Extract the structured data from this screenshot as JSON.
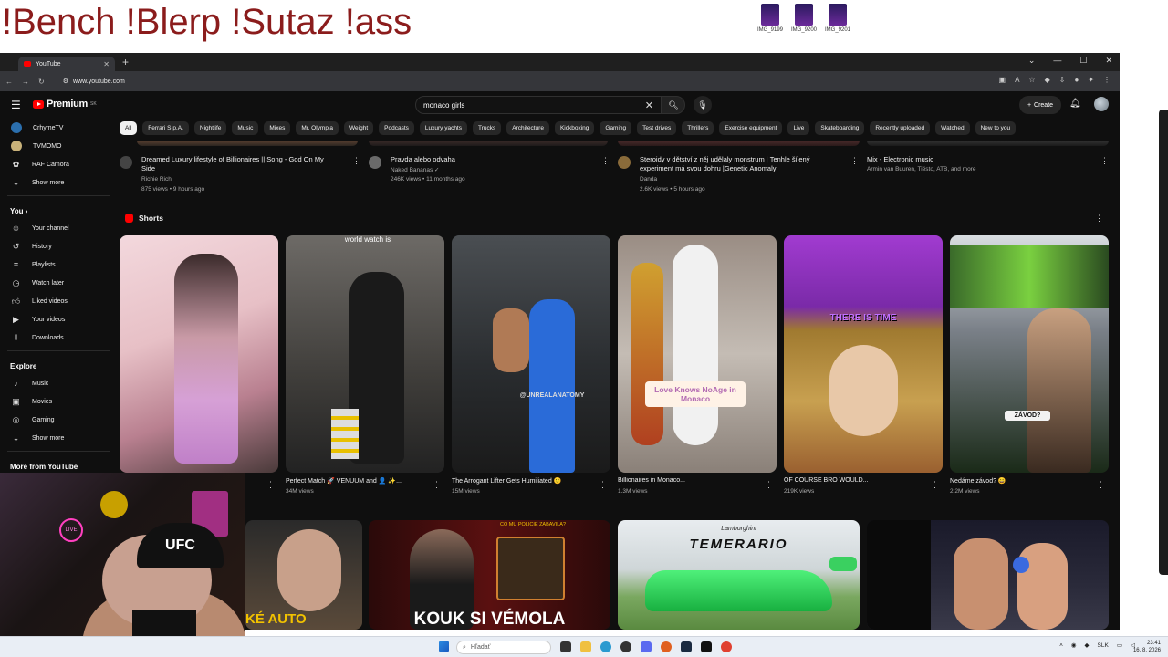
{
  "overlay": {
    "title": "!Bench !Blerp !Sutaz !ass"
  },
  "desktop": {
    "icons": [
      "IMG_9199",
      "IMG_9200",
      "IMG_9201"
    ]
  },
  "browser": {
    "tab_title": "YouTube",
    "url": "www.youtube.com"
  },
  "youtube": {
    "logo_text": "Premium",
    "logo_region": "SK",
    "search_value": "monaco girls",
    "create_label": "Create",
    "sidebar": {
      "subscriptions": [
        {
          "label": "CrhymeTV"
        },
        {
          "label": "TVMOMO"
        },
        {
          "label": "RAF Camora"
        },
        {
          "label": "Show more"
        }
      ],
      "you_heading": "You",
      "you_items": [
        {
          "label": "Your channel",
          "icon": "user-icon"
        },
        {
          "label": "History",
          "icon": "history-icon"
        },
        {
          "label": "Playlists",
          "icon": "playlists-icon"
        },
        {
          "label": "Watch later",
          "icon": "clock-icon"
        },
        {
          "label": "Liked videos",
          "icon": "thumb-up-icon"
        },
        {
          "label": "Your videos",
          "icon": "video-icon"
        },
        {
          "label": "Downloads",
          "icon": "download-icon"
        }
      ],
      "explore_heading": "Explore",
      "explore_items": [
        {
          "label": "Music",
          "icon": "music-icon"
        },
        {
          "label": "Movies",
          "icon": "movies-icon"
        },
        {
          "label": "Gaming",
          "icon": "gaming-icon"
        },
        {
          "label": "Show more",
          "icon": "chevron-down-icon"
        }
      ],
      "more_heading": "More from YouTube"
    },
    "chips": [
      "All",
      "Ferrari S.p.A.",
      "Nightlife",
      "Music",
      "Mixes",
      "Mr. Olympia",
      "Weight",
      "Podcasts",
      "Luxury yachts",
      "Trucks",
      "Architecture",
      "Kickboxing",
      "Gaming",
      "Test drives",
      "Thrillers",
      "Exercise equipment",
      "Live",
      "Skateboarding",
      "Recently uploaded",
      "Watched",
      "New to you"
    ],
    "videos": [
      {
        "title": "Dreamed Luxury lifestyle of Billionaires || Song - God On My Side",
        "channel": "Richie Rich",
        "meta": "875 views • 9 hours ago"
      },
      {
        "title": "Pravda alebo odvaha",
        "channel": "Naked Bananas ✓",
        "meta": "246K views • 11 months ago"
      },
      {
        "title": "Steroidy v dětství z něj udělaly monstrum | Tenhle šílený experiment má svou dohru |Genetic Anomaly",
        "channel": "Danda",
        "meta": "2.6K views • 5 hours ago"
      },
      {
        "title": "Mix - Electronic music",
        "channel": "Armin van Buuren, Tiësto, ATB, and more",
        "meta": ""
      }
    ],
    "shorts_heading": "Shorts",
    "shorts": [
      {
        "title": "",
        "views": ""
      },
      {
        "title": "Perfect Match 🚀 VENUUM and 👤 ✨...",
        "views": "34M views",
        "overlay": "world watch is"
      },
      {
        "title": "The Arrogant Lifter Gets Humiliated 🙂",
        "views": "15M views",
        "overlay": "@UNREALANATOMY"
      },
      {
        "title": "Billionaires in Monaco...",
        "views": "1.3M views",
        "overlay": "Love Knows NoAge in Monaco"
      },
      {
        "title": "OF COURSE BRO WOULD...",
        "views": "219K views",
        "overlay": "THERE IS TIME"
      },
      {
        "title": "Nedáme závod? 😄",
        "views": "2.2M views",
        "overlay": "ZÁVOD?"
      }
    ],
    "row3": [
      {
        "overlay": "KÉ AUTO"
      },
      {
        "overlay": "KOUK SI VÉMOLA",
        "caption": "CO MU POLICIE ZABAVILA?"
      },
      {
        "brand": "Lamborghini",
        "overlay": "TEMERARIO"
      },
      {
        "overlay": ""
      }
    ]
  },
  "webcam": {
    "cap_text": "UFC",
    "neon": "LIVE"
  },
  "taskbar": {
    "search_placeholder": "Hľadať",
    "lang": "SLK",
    "time": "23:41",
    "date": "16. 8. 2026"
  }
}
